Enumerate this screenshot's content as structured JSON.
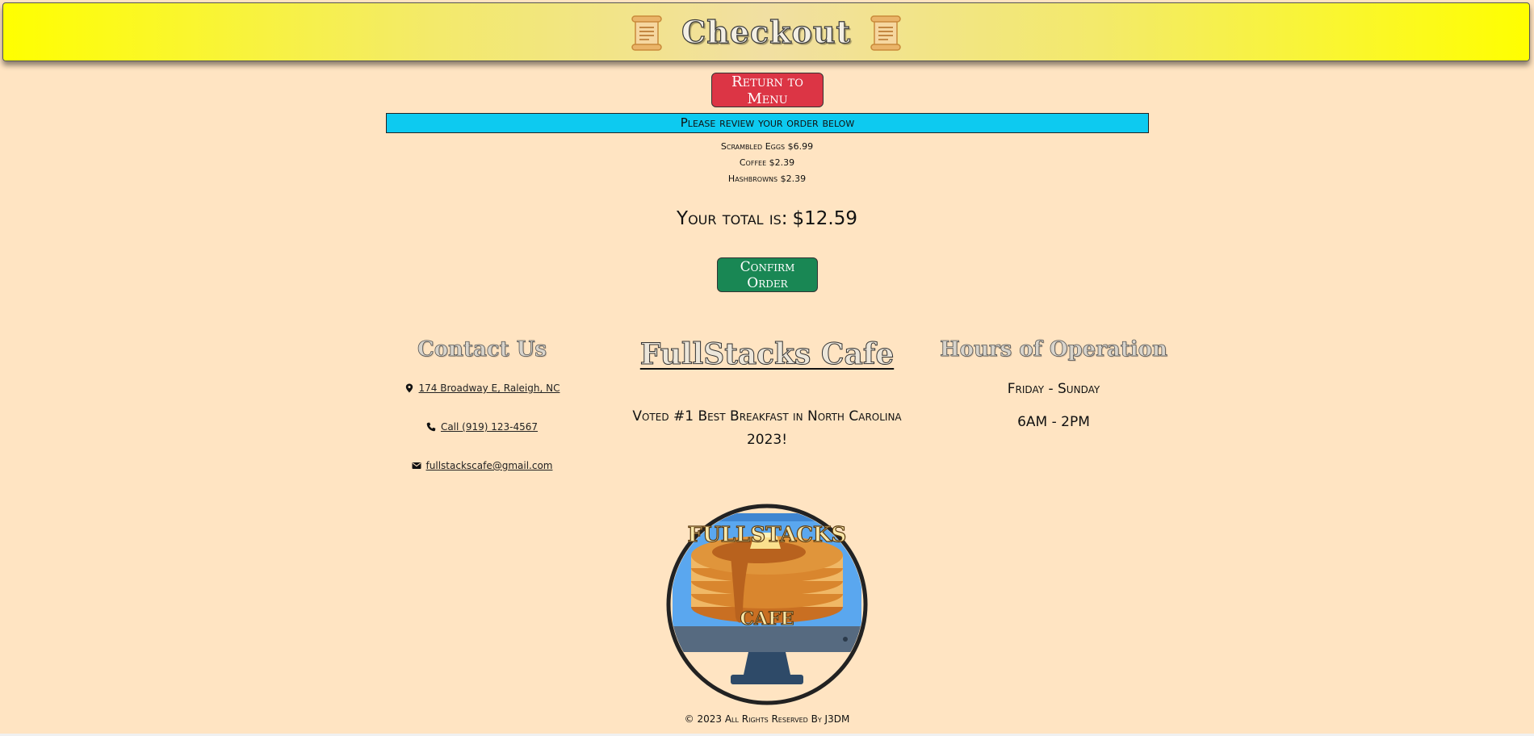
{
  "header": {
    "title": "Checkout",
    "icon": "scroll-icon"
  },
  "actions": {
    "return_label": "Return to Menu",
    "confirm_label": "Confirm Order"
  },
  "review": {
    "banner": "Please review your order below"
  },
  "order": {
    "items": [
      "Scrambled Eggs $6.99",
      "Coffee $2.39",
      "Hashbrowns $2.39"
    ],
    "total_label": "Your total is:",
    "total_value": "$12.59"
  },
  "footer": {
    "contact": {
      "title": "Contact Us",
      "address": " 174 Broadway E, Raleigh, NC",
      "phone": " Call (919) 123-4567",
      "email": " fullstackscafe@gmail.com"
    },
    "brand": {
      "title": "FullStacks Cafe",
      "tagline": "Voted #1 Best Breakfast in North Carolina 2023!",
      "logo_text_top": "FULLSTACKS",
      "logo_text_bottom": "CAFE"
    },
    "hours": {
      "title": "Hours of Operation",
      "days": "Friday - Sunday",
      "times": "6AM - 2PM"
    },
    "copyright": "© 2023 All Rights Reserved By J3DM"
  },
  "colors": {
    "background": "#ffe4c2",
    "header_gradient_edge": "#ffff00",
    "return_button": "#dc3545",
    "confirm_button": "#198754",
    "review_banner": "#0dcaf0"
  }
}
